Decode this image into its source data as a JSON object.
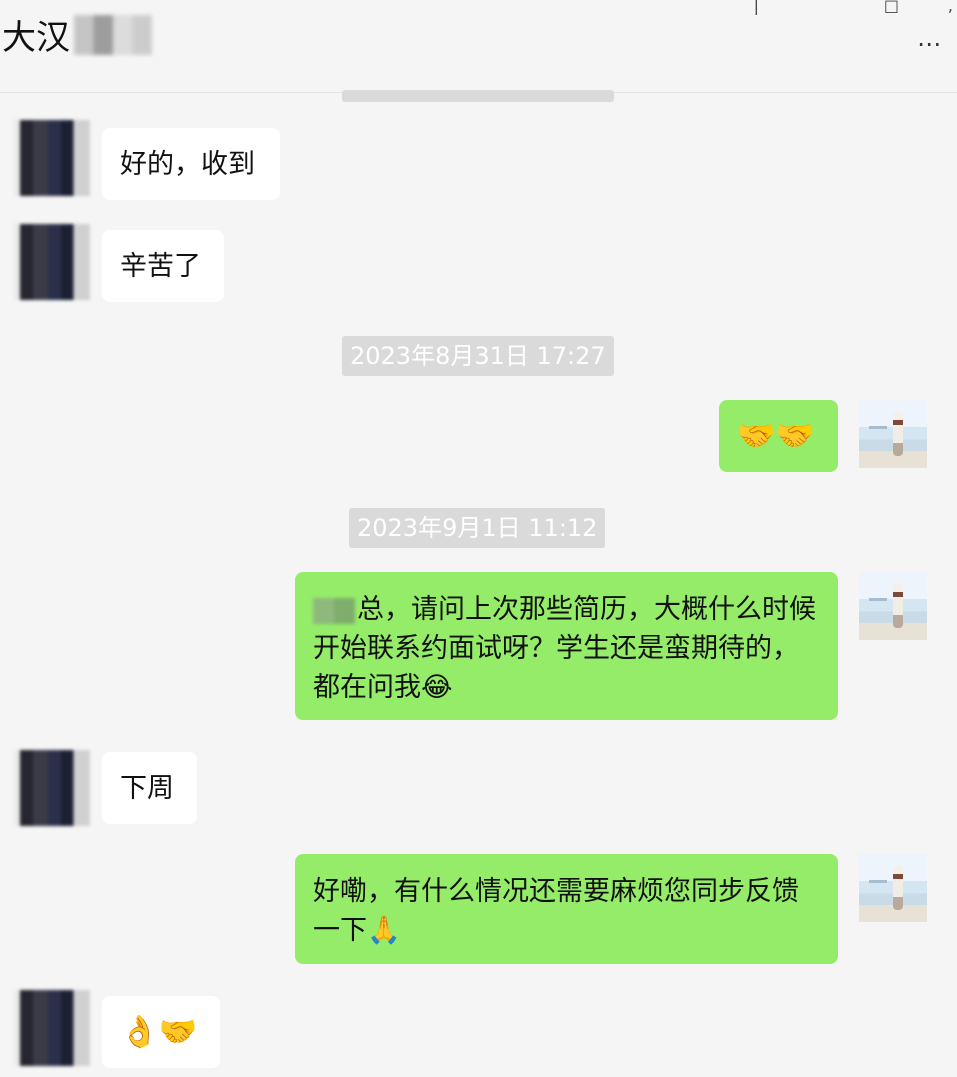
{
  "header": {
    "title": "大汉",
    "more_icon": "⋯"
  },
  "timestamps": {
    "t1": "2023年8月31日 17:27",
    "t2": "2023年9月1日 11:12"
  },
  "messages": [
    {
      "side": "left",
      "text": "好的，收到"
    },
    {
      "side": "left",
      "text": "辛苦了"
    },
    {
      "side": "right",
      "text": "🤝🤝"
    },
    {
      "side": "right",
      "text_line1": "总，请问上次那些简历，大概什么时候",
      "text_line2": "开始联系约面试呀？学生还是蛮期待的，",
      "text_line3": "都在问我😂"
    },
    {
      "side": "left",
      "text": "下周"
    },
    {
      "side": "right",
      "text_line1": "好嘞，有什么情况还需要麻烦您同步反馈",
      "text_line2": "一下🙏"
    },
    {
      "side": "left",
      "text": "👌🤝"
    }
  ],
  "colors": {
    "background": "#f5f5f5",
    "incoming_bubble": "#ffffff",
    "outgoing_bubble": "#95ec69",
    "timestamp_bg": "#dadada"
  }
}
